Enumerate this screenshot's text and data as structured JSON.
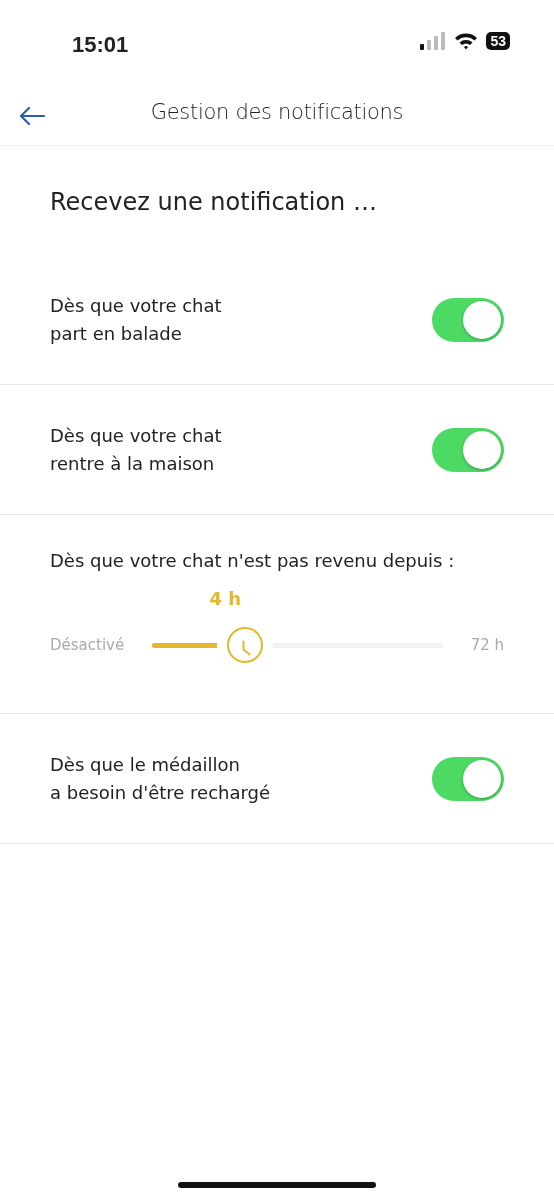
{
  "status_bar": {
    "time": "15:01",
    "battery": "53"
  },
  "header": {
    "title": "Gestion des notifications"
  },
  "heading": "Recevez une notification …",
  "items": [
    {
      "kind": "toggle",
      "label": "Dès que votre chat\npart en balade",
      "on": true
    },
    {
      "kind": "toggle",
      "label": "Dès que votre chat\nrentre à la maison",
      "on": true
    },
    {
      "kind": "slider",
      "label": "Dès que votre chat n'est pas revenu depuis :",
      "value": "4 h",
      "min_label": "Désactivé",
      "max_label": "72 h",
      "level": 0.32
    },
    {
      "kind": "toggle",
      "label": "Dès que le médaillon\na besoin d'être rechargé",
      "on": true
    }
  ]
}
